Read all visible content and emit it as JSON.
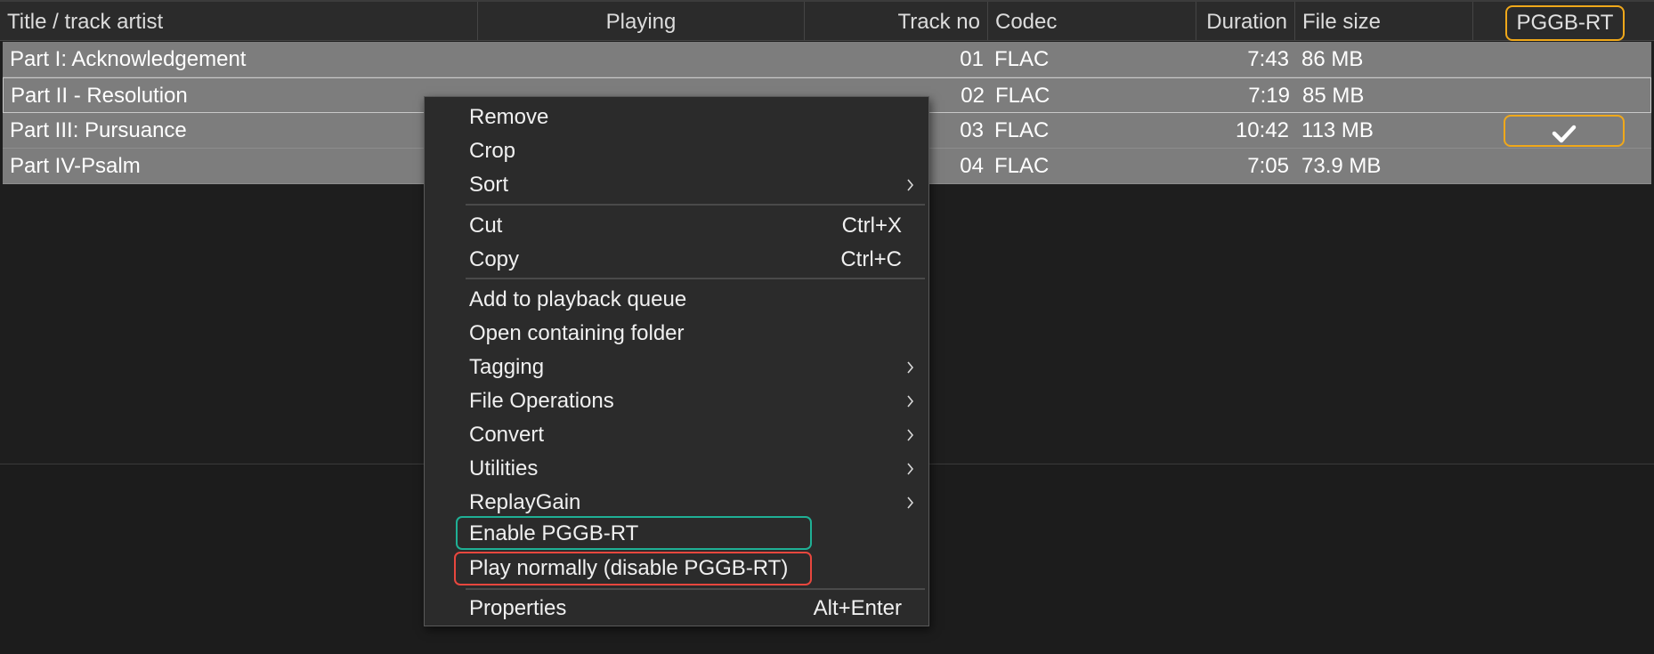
{
  "columns": {
    "title": "Title / track artist",
    "playing": "Playing",
    "track_no": "Track no",
    "codec": "Codec",
    "duration": "Duration",
    "file_size": "File size",
    "pggb": "PGGB-RT"
  },
  "tracks": [
    {
      "title": "Part I: Acknowledgement",
      "track_no": "01",
      "codec": "FLAC",
      "duration": "7:43",
      "file_size": "86 MB",
      "pggb_enabled": false
    },
    {
      "title": "Part II - Resolution",
      "track_no": "02",
      "codec": "FLAC",
      "duration": "7:19",
      "file_size": "85 MB",
      "pggb_enabled": false
    },
    {
      "title": "Part III: Pursuance",
      "track_no": "03",
      "codec": "FLAC",
      "duration": "10:42",
      "file_size": "113 MB",
      "pggb_enabled": true
    },
    {
      "title": "Part IV-Psalm",
      "track_no": "04",
      "codec": "FLAC",
      "duration": "7:05",
      "file_size": "73.9 MB",
      "pggb_enabled": false
    }
  ],
  "context_menu": {
    "remove": "Remove",
    "crop": "Crop",
    "sort": "Sort",
    "cut": "Cut",
    "cut_shortcut": "Ctrl+X",
    "copy": "Copy",
    "copy_shortcut": "Ctrl+C",
    "add_to_queue": "Add to playback queue",
    "open_folder": "Open containing folder",
    "tagging": "Tagging",
    "file_operations": "File Operations",
    "convert": "Convert",
    "utilities": "Utilities",
    "replaygain": "ReplayGain",
    "enable_pggb": "Enable PGGB-RT",
    "play_normally": "Play normally (disable PGGB-RT)",
    "properties": "Properties",
    "properties_shortcut": "Alt+Enter"
  },
  "colors": {
    "highlight_orange": "#f0a81a",
    "highlight_green": "#1fb095",
    "highlight_red": "#e8473e",
    "selected_row": "#7d7d7d",
    "menu_background": "#2b2b2b"
  },
  "icons": {
    "pggb_enabled": "checkmark-icon",
    "submenu": "chevron-right-icon"
  }
}
